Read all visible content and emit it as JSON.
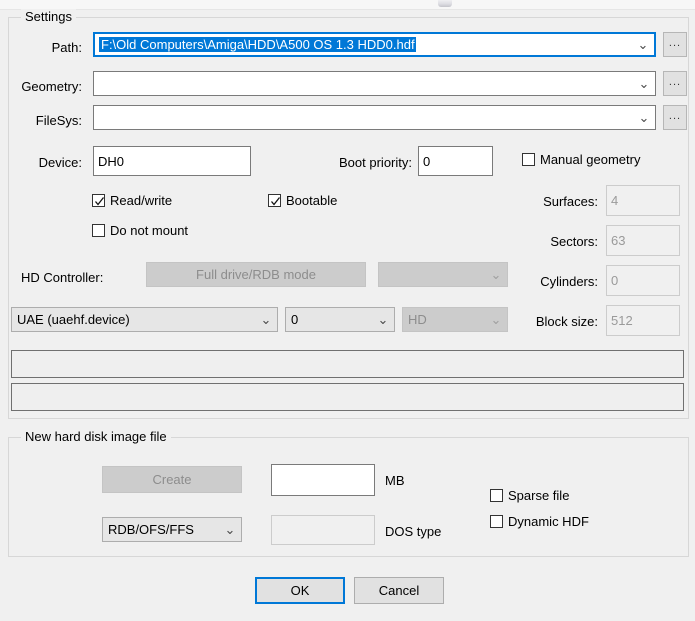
{
  "window": {
    "background": "#f0f0f0",
    "accent": "#0078d7"
  },
  "settings_group": {
    "title": "Settings",
    "path": {
      "label": "Path:",
      "value": "F:\\Old Computers\\Amiga\\HDD\\A500 OS 1.3 HDD0.hdf",
      "selected": true,
      "browse_label": "...",
      "arrow": "⌄"
    },
    "geometry": {
      "label": "Geometry:",
      "value": "",
      "browse_label": "...",
      "arrow": "⌄"
    },
    "filesys": {
      "label": "FileSys:",
      "value": "",
      "browse_label": "...",
      "arrow": "⌄"
    },
    "device": {
      "label": "Device:",
      "value": "DH0"
    },
    "boot_priority": {
      "label": "Boot priority:",
      "value": "0"
    },
    "manual_geometry": {
      "label": "Manual geometry",
      "checked": false
    },
    "read_write": {
      "label": "Read/write",
      "checked": true
    },
    "bootable": {
      "label": "Bootable",
      "checked": true
    },
    "do_not_mount": {
      "label": "Do not mount",
      "checked": false
    },
    "surfaces": {
      "label": "Surfaces:",
      "value": "4",
      "disabled": true
    },
    "sectors": {
      "label": "Sectors:",
      "value": "63",
      "disabled": true
    },
    "cylinders": {
      "label": "Cylinders:",
      "value": "0",
      "disabled": true
    },
    "block_size": {
      "label": "Block size:",
      "value": "512",
      "disabled": true
    },
    "hd_controller": {
      "label": "HD Controller:",
      "mode_button_label": "Full drive/RDB mode",
      "mode_button_disabled": true,
      "mode_combo_value": "",
      "mode_combo_disabled": true,
      "controller_value": "UAE (uaehf.device)",
      "unit_value": "0",
      "type_value": "HD",
      "type_disabled": true,
      "arrow": "⌄"
    },
    "info_panel_1": "",
    "info_panel_2": ""
  },
  "new_hdf_group": {
    "title": "New hard disk image file",
    "create_button": {
      "label": "Create",
      "disabled": true
    },
    "size_field": {
      "value": "",
      "unit_label": "MB"
    },
    "format_combo": {
      "value": "RDB/OFS/FFS",
      "arrow": "⌄"
    },
    "dostype_field": {
      "value": "",
      "label": "DOS type",
      "disabled": true
    },
    "sparse_file": {
      "label": "Sparse file",
      "checked": false
    },
    "dynamic_hdf": {
      "label": "Dynamic HDF",
      "checked": false
    }
  },
  "dialog_buttons": {
    "ok": "OK",
    "cancel": "Cancel"
  }
}
